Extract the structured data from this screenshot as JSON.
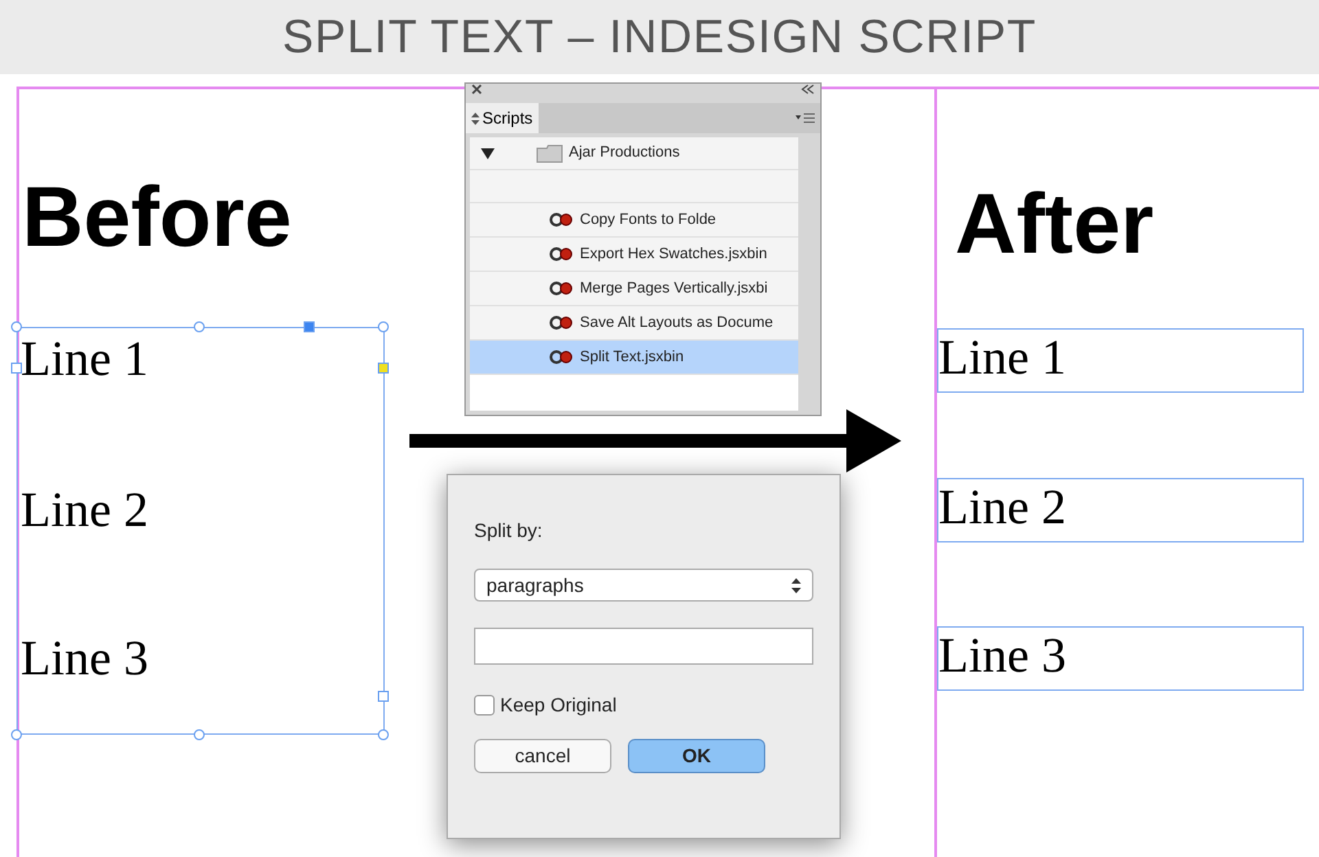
{
  "banner": {
    "title": "SPLIT TEXT – INDESIGN SCRIPT"
  },
  "before": {
    "heading": "Before",
    "lines": [
      "Line 1",
      "Line 2",
      "Line 3"
    ]
  },
  "scripts_panel": {
    "title": "Scripts",
    "folder": {
      "name": "Ajar Productions",
      "expanded": true
    },
    "items": [
      {
        "name": "Copy Fonts to Folde",
        "selected": false
      },
      {
        "name": "Export Hex Swatches.jsxbin",
        "selected": false
      },
      {
        "name": "Merge Pages Vertically.jsxbi",
        "selected": false
      },
      {
        "name": "Save Alt Layouts as Docume",
        "selected": false
      },
      {
        "name": "Split Text.jsxbin",
        "selected": true
      }
    ]
  },
  "dialog": {
    "label": "Split by:",
    "select_value": "paragraphs",
    "keep_original": {
      "label": "Keep Original",
      "checked": false
    },
    "buttons": [
      {
        "label": "cancel",
        "default": false
      },
      {
        "label": "OK",
        "default": true
      }
    ]
  },
  "after": {
    "heading": "After",
    "lines": [
      "Line 1",
      "Line 2",
      "Line 3"
    ]
  }
}
